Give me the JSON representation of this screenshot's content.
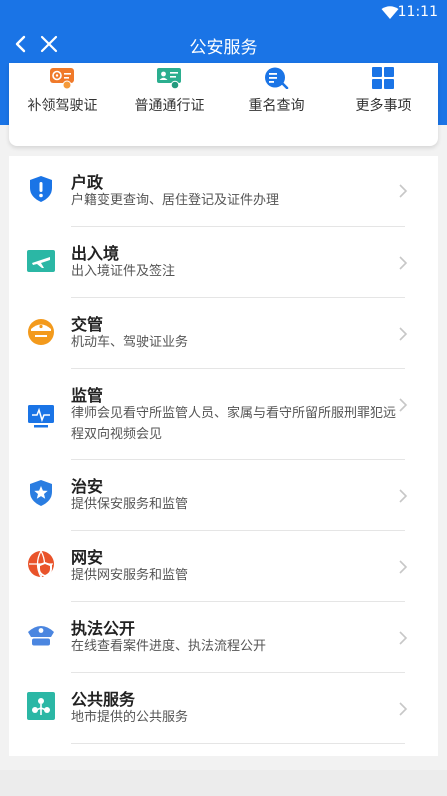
{
  "status_bar": {
    "time": "11:11"
  },
  "header": {
    "title": "公安服务"
  },
  "quick_actions": [
    {
      "label": "补领驾驶证",
      "icon": "driver-license-icon",
      "color": "#f07a2a"
    },
    {
      "label": "普通通行证",
      "icon": "pass-card-icon",
      "color": "#2bae8f"
    },
    {
      "label": "重名查询",
      "icon": "name-search-icon",
      "color": "#1a74e6"
    },
    {
      "label": "更多事项",
      "icon": "grid-more-icon",
      "color": "#1a74e6"
    }
  ],
  "services": [
    {
      "title": "户政",
      "subtitle": "户籍变更查询、居住登记及证件办理",
      "icon": "shield-alert-icon",
      "color": "#1a74e6"
    },
    {
      "title": "出入境",
      "subtitle": "出入境证件及签注",
      "icon": "airplane-icon",
      "color": "#2bb7a5"
    },
    {
      "title": "交管",
      "subtitle": "机动车、驾驶证业务",
      "icon": "traffic-police-icon",
      "color": "#f39a1c"
    },
    {
      "title": "监管",
      "subtitle": "律师会见看守所监管人员、家属与看守所留所服刑罪犯远程双向视频会见",
      "icon": "monitor-icon",
      "color": "#1a74e6"
    },
    {
      "title": "治安",
      "subtitle": "提供保安服务和监管",
      "icon": "star-shield-icon",
      "color": "#2a7de1"
    },
    {
      "title": "网安",
      "subtitle": "提供网安服务和监管",
      "icon": "network-security-icon",
      "color": "#e9532a"
    },
    {
      "title": "执法公开",
      "subtitle": "在线查看案件进度、执法流程公开",
      "icon": "police-cap-icon",
      "color": "#4b86e0"
    },
    {
      "title": "公共服务",
      "subtitle": "地市提供的公共服务",
      "icon": "public-service-icon",
      "color": "#2bb7a5"
    }
  ]
}
